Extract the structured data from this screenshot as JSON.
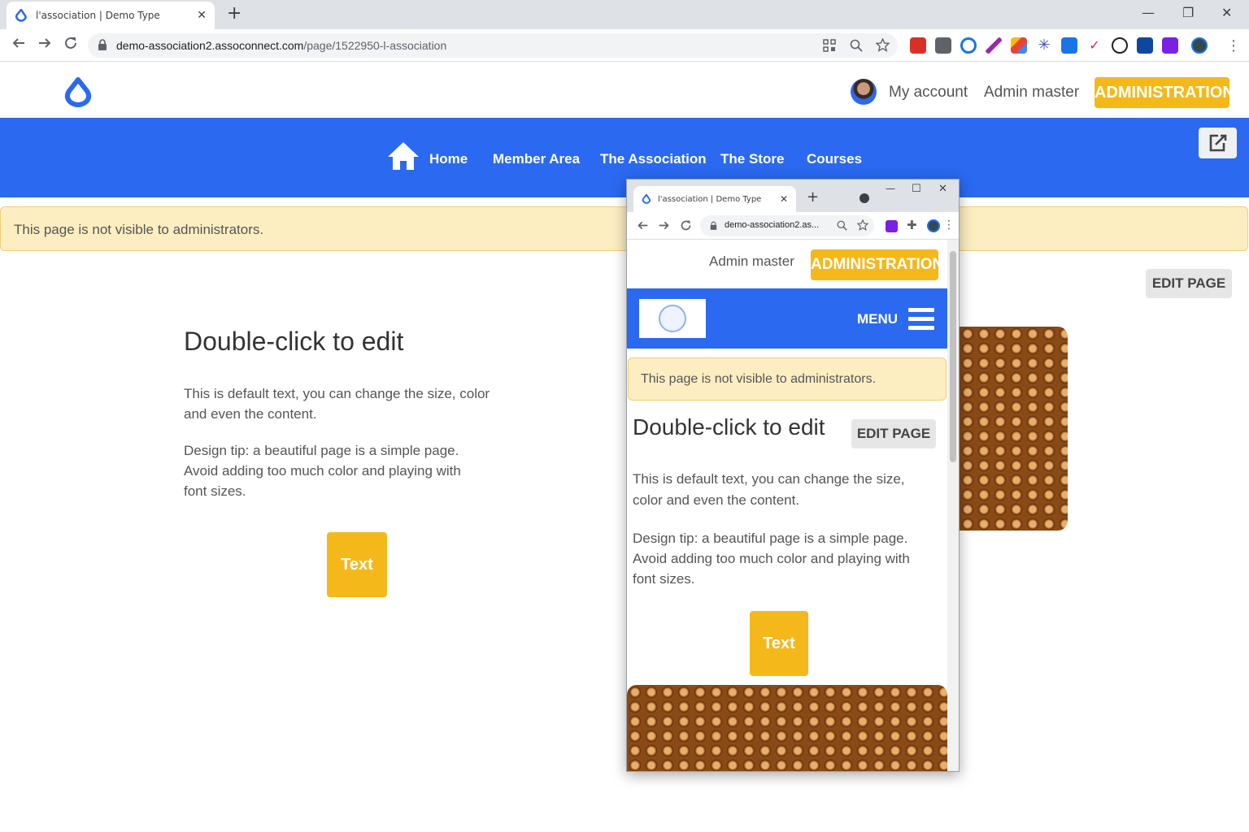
{
  "browser": {
    "tab_title": "l'association | Demo Type",
    "tab_close": "✕",
    "new_tab": "+",
    "url_host": "demo-association2.assoconnect.com",
    "url_path": "/page/1522950-l-association",
    "window_minimize": "—",
    "window_restore": "❐",
    "window_close": "✕"
  },
  "header": {
    "my_account": "My account",
    "admin_master": "Admin master",
    "administration": "ADMINISTRATION"
  },
  "nav": {
    "items": [
      "Home",
      "Member Area",
      "The Association",
      "The Store",
      "Courses"
    ]
  },
  "alert": {
    "text": "This page is not visible to administrators."
  },
  "main": {
    "edit_page": "EDIT PAGE",
    "title": "Double-click to edit",
    "para1_line1": "This is default text, you can change the size, color",
    "para1_line2": "and even the content.",
    "para2_line1": "Design tip: a beautiful page is a simple page.",
    "para2_line2": "Avoid adding too much color and playing with",
    "para2_line3": "font sizes.",
    "button": "Text"
  },
  "popup": {
    "tab_title": "l'association | Demo Type",
    "tab_close": "✕",
    "new_tab": "+",
    "url": "demo-association2.as...",
    "window_minimize": "—",
    "window_restore": "☐",
    "window_close": "✕",
    "admin_master": "Admin master",
    "administration": "ADMINISTRATION",
    "menu": "MENU",
    "alert": "This page is not visible to administrators.",
    "title": "Double-click to edit",
    "edit_page": "EDIT PAGE",
    "para1_line1": "This is default text, you can change the size,",
    "para1_line2": "color and even the content.",
    "para2_line1": "Design tip: a beautiful page is a simple page.",
    "para2_line2": "Avoid adding too much color and playing with",
    "para2_line3": "font sizes.",
    "button": "Text"
  },
  "colors": {
    "brand_blue": "#2a69f0",
    "accent_yellow": "#f5b81b",
    "alert_bg": "#fdeec2"
  }
}
